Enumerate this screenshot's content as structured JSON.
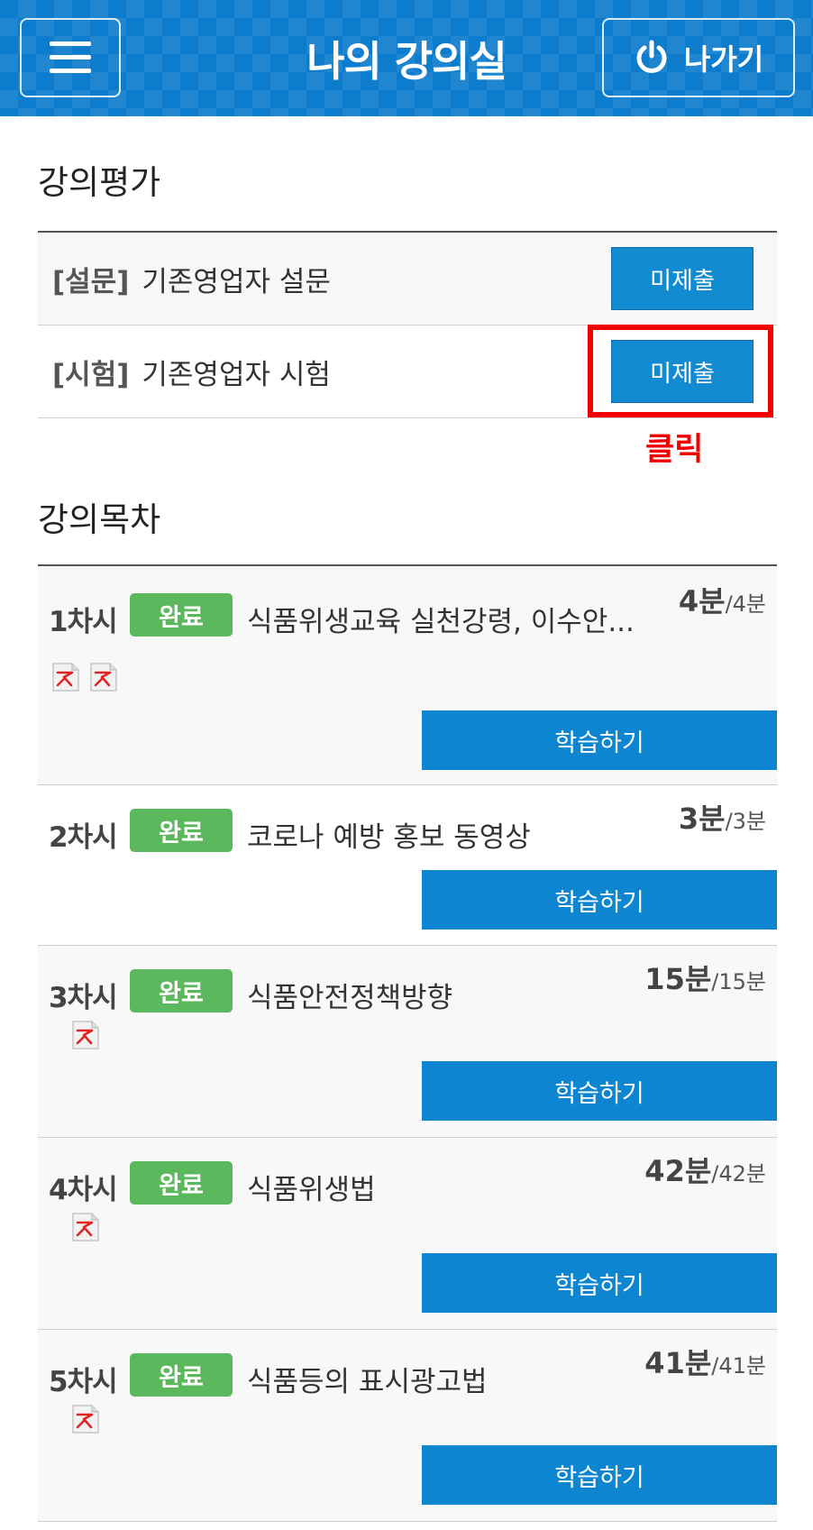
{
  "header": {
    "title": "나의 강의실",
    "exit_label": "나가기",
    "menu_icon": "hamburger-menu-icon",
    "exit_icon": "power-icon",
    "color": "#0d7ccc"
  },
  "evaluation": {
    "section_title": "강의평가",
    "items": [
      {
        "tag": "[설문]",
        "label": "기존영업자 설문",
        "button": "미제출"
      },
      {
        "tag": "[시험]",
        "label": "기존영업자 시험",
        "button": "미제출"
      }
    ],
    "annotation": "클릭",
    "annotation_color": "#f20000"
  },
  "lectures": {
    "section_title": "강의목차",
    "study_label": "학습하기",
    "items": [
      {
        "num": "1차시",
        "status": "완료",
        "title": "식품위생교육 실천강령, 이수안...",
        "time_big": "4분",
        "time_small": "/4분",
        "pdf_count": 2
      },
      {
        "num": "2차시",
        "status": "완료",
        "title": "코로나 예방 홍보 동영상",
        "time_big": "3분",
        "time_small": "/3분",
        "pdf_count": 0
      },
      {
        "num": "3차시",
        "status": "완료",
        "title": "식품안전정책방향",
        "time_big": "15분",
        "time_small": "/15분",
        "pdf_count": 1
      },
      {
        "num": "4차시",
        "status": "완료",
        "title": "식품위생법",
        "time_big": "42분",
        "time_small": "/42분",
        "pdf_count": 1
      },
      {
        "num": "5차시",
        "status": "완료",
        "title": "식품등의 표시광고법",
        "time_big": "41분",
        "time_small": "/41분",
        "pdf_count": 1
      }
    ],
    "status_color": "#5cb85c",
    "button_color": "#0d85d0"
  }
}
